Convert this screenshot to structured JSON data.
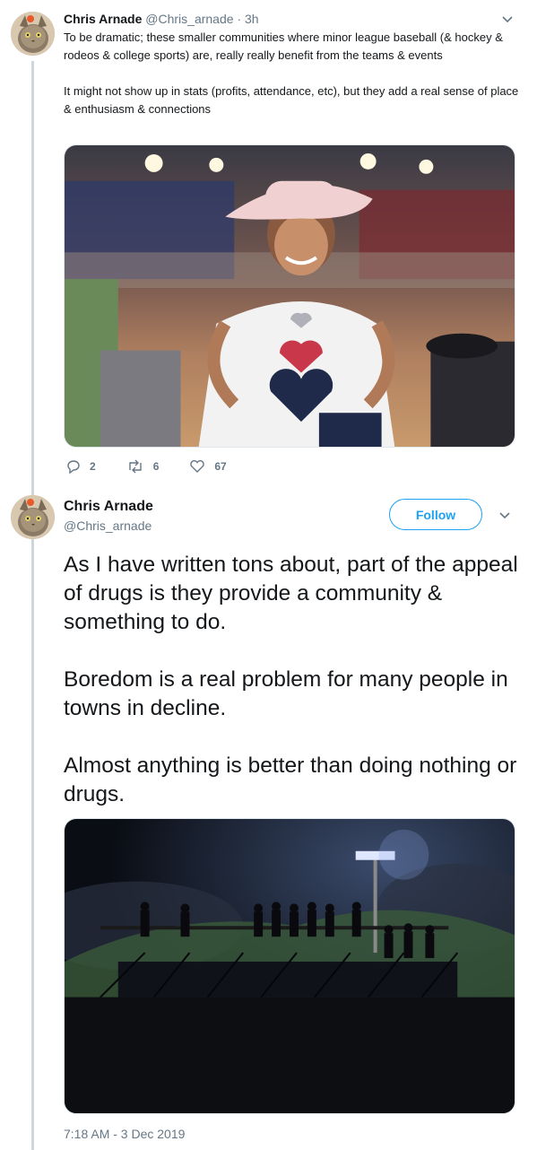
{
  "colors": {
    "accent": "#1da1f2",
    "muted": "#657786",
    "text": "#14171a",
    "thread_line": "#ccd6dd"
  },
  "tweet1": {
    "author_name": "Chris Arnade",
    "handle": "@Chris_arnade",
    "separator": "·",
    "time": "3h",
    "paragraphs": [
      "To be dramatic; these smaller communities where minor league baseball (& hockey & rodeos & college sports) are, really really benefit from the teams & events",
      "It might not show up in stats (profits, attendance, etc), but they add a real sense of place & enthusiasm & connections"
    ],
    "actions": {
      "replies": "2",
      "retweets": "6",
      "likes": "67"
    },
    "media_icon": "photo-rodeo-girl-cowboy-hat"
  },
  "tweet2": {
    "author_name": "Chris Arnade",
    "handle": "@Chris_arnade",
    "follow_label": "Follow",
    "paragraphs": [
      "As I have written tons about, part of the appeal of drugs is they provide a community & something to do.",
      "Boredom is a real problem for many people in towns in decline.",
      "Almost anything is better than doing nothing or drugs."
    ],
    "media_icon": "photo-night-rodeo-bleachers",
    "timestamp": "7:18 AM - 3 Dec 2019"
  }
}
